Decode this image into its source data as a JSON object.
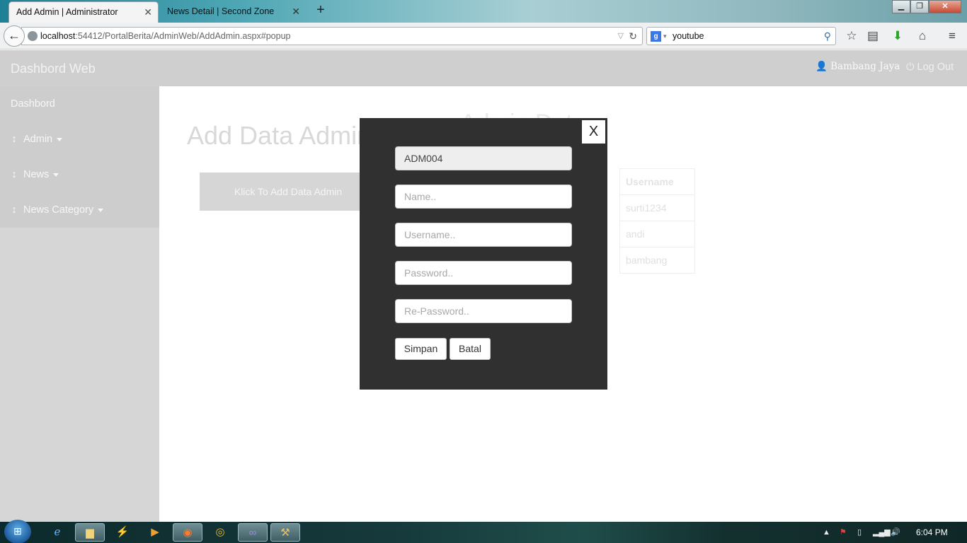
{
  "browser": {
    "tabs": [
      {
        "title": "Add Admin | Administrator",
        "active": true
      },
      {
        "title": "News Detail | Second Zone",
        "active": false
      }
    ],
    "tab_close_glyph": "✕",
    "new_tab_glyph": "+",
    "url_host": "localhost",
    "url_path": ":54412/PortalBerita/AdminWeb/AddAdmin.aspx#popup",
    "search_value": "youtube",
    "icons": [
      "back-arrow-icon",
      "globe-icon",
      "reload-icon",
      "google-icon",
      "search-icon",
      "star-icon",
      "reading-list-icon",
      "download-icon",
      "home-icon",
      "menu-icon"
    ]
  },
  "app": {
    "brand": "Dashbord Web",
    "user_name": "Bambang Jaya",
    "logout_label": "Log Out",
    "sidebar": {
      "items": [
        {
          "label": "Dashbord"
        },
        {
          "label": "Admin"
        },
        {
          "label": "News"
        },
        {
          "label": "News Category"
        }
      ]
    },
    "page_title": "Add Data Admin",
    "background_heading": "Admin Dat",
    "add_button_label": "Klick To Add Data Admin",
    "table": {
      "header": "Username",
      "rows": [
        "surti1234",
        "andi",
        "bambang"
      ]
    }
  },
  "modal": {
    "close_label": "X",
    "id_value": "ADM004",
    "name_placeholder": "Name..",
    "username_placeholder": "Username..",
    "password_placeholder": "Password..",
    "repassword_placeholder": "Re-Password..",
    "save_label": "Simpan",
    "cancel_label": "Batal"
  },
  "taskbar": {
    "clock": "6:04 PM",
    "apps": [
      "internet-explorer-icon",
      "file-explorer-icon",
      "winamp-icon",
      "media-player-icon",
      "firefox-icon",
      "chrome-icon",
      "visual-studio-icon",
      "tools-icon"
    ]
  }
}
